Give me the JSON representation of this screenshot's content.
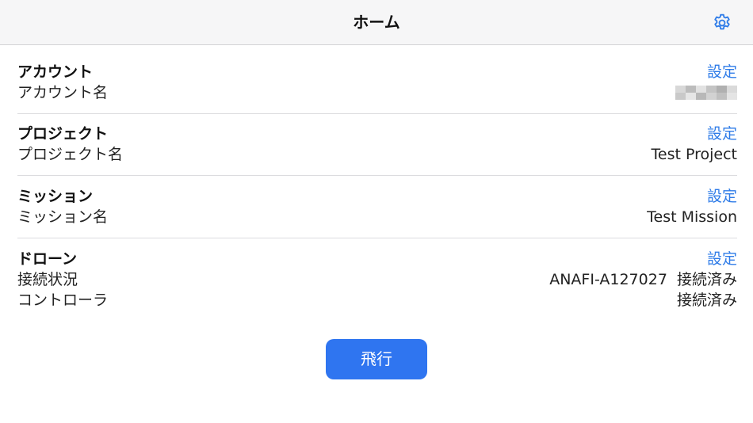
{
  "header": {
    "title": "ホーム",
    "settings_icon": "gear-icon",
    "accent_color": "#2f7ce8"
  },
  "account": {
    "title": "アカウント",
    "setting_link": "設定",
    "label": "アカウント名"
  },
  "project": {
    "title": "プロジェクト",
    "setting_link": "設定",
    "label": "プロジェクト名",
    "value": "Test Project"
  },
  "mission": {
    "title": "ミッション",
    "setting_link": "設定",
    "label": "ミッション名",
    "value": "Test Mission"
  },
  "drone": {
    "title": "ドローン",
    "setting_link": "設定",
    "connection_label": "接続状況",
    "connection_value": "ANAFI-A127027  接続済み",
    "controller_label": "コントローラ",
    "controller_value": "接続済み"
  },
  "actions": {
    "fly_label": "飛行",
    "fly_color": "#2f75f0"
  }
}
